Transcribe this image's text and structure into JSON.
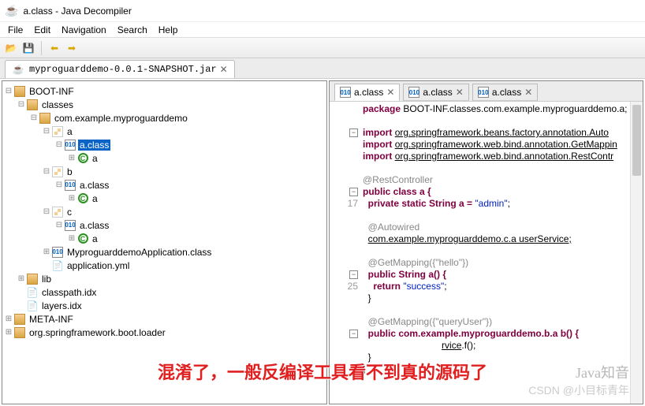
{
  "window": {
    "title": "a.class - Java Decompiler"
  },
  "menu": [
    "File",
    "Edit",
    "Navigation",
    "Search",
    "Help"
  ],
  "main_tab": {
    "label": "myproguarddemo-0.0.1-SNAPSHOT.jar"
  },
  "tree": {
    "n0": "BOOT-INF",
    "n1": "classes",
    "n2": "com.example.myproguarddemo",
    "n3": "a",
    "n4": "a.class",
    "n5": "a",
    "n6": "b",
    "n7": "a.class",
    "n8": "a",
    "n9": "c",
    "n10": "a.class",
    "n11": "a",
    "n12": "MyproguarddemoApplication.class",
    "n13": "application.yml",
    "n14": "lib",
    "n15": "classpath.idx",
    "n16": "layers.idx",
    "n17": "META-INF",
    "n18": "org.springframework.boot.loader"
  },
  "editor_tabs": [
    {
      "label": "a.class"
    },
    {
      "label": "a.class"
    },
    {
      "label": "a.class"
    }
  ],
  "code": {
    "pkg_kw": "package",
    "pkg": "BOOT-INF.classes.com.example.myproguarddemo.a;",
    "imp_kw": "import",
    "imp1": "org.springframework.beans.factory.annotation.Auto",
    "imp2": "org.springframework.web.bind.annotation.GetMappin",
    "imp3": "org.springframework.web.bind.annotation.RestContr",
    "ann_rest": "@RestController",
    "cls_decl": "public class a {",
    "ln17": "17",
    "fld": "  private static String a = ",
    "fld_str": "\"admin\"",
    "semi": ";",
    "ann_auto": "@Autowired",
    "svc": "com.example.myproguarddemo.c.a userService;",
    "ann_get1": "@GetMapping({\"hello\"})",
    "m1": "public String a() {",
    "ln25": "25",
    "ret": "    return ",
    "ret_str": "\"success\"",
    "brace": "  }",
    "ann_get2": "@GetMapping({\"queryUser\"})",
    "m2": "public com.example.myproguarddemo.b.a b() {",
    "body2_a": "rvice",
    "body2_b": ".f();",
    "end": "}"
  },
  "overlay": "混淆了，一般反编译工具看不到真的源码了",
  "wm1": "Java知音",
  "wm2": "CSDN @小目标青年"
}
